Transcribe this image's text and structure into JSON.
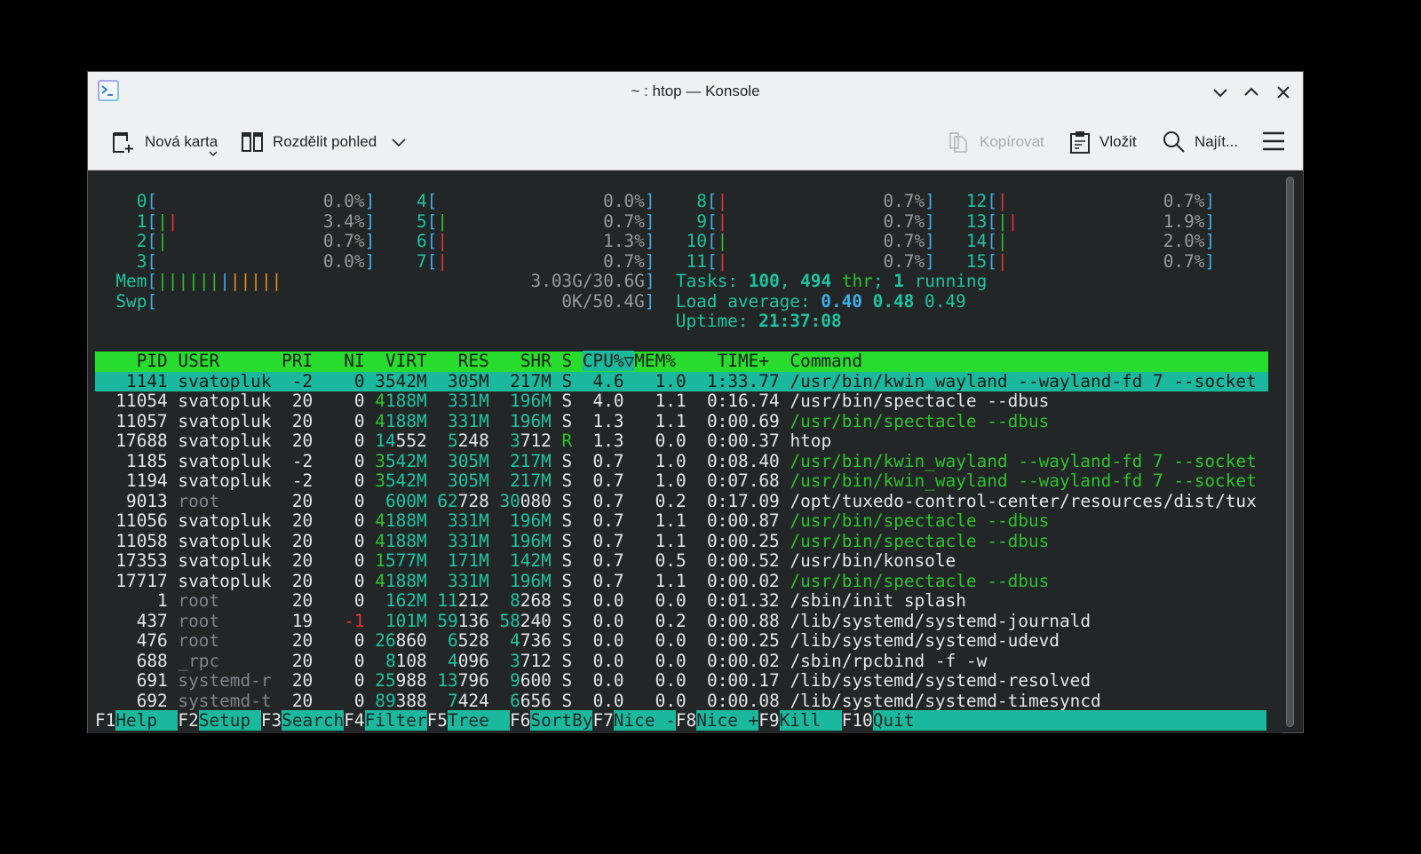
{
  "window": {
    "title": "~ : htop — Konsole"
  },
  "toolbar": {
    "new_tab": "Nová karta",
    "split_view": "Rozdělit pohled",
    "copy": "Kopírovat",
    "paste": "Vložit",
    "find": "Najít..."
  },
  "colors": {
    "terminal_bg": "#232627",
    "header_green": "#27dc2c",
    "selection_teal": "#1ab89c"
  },
  "meters": {
    "cpus": [
      {
        "label": "0",
        "value": "0.0%",
        "bars": ""
      },
      {
        "label": "1",
        "value": "3.4%",
        "bars": "gr"
      },
      {
        "label": "2",
        "value": "0.7%",
        "bars": "g"
      },
      {
        "label": "3",
        "value": "0.0%",
        "bars": ""
      },
      {
        "label": "4",
        "value": "0.0%",
        "bars": ""
      },
      {
        "label": "5",
        "value": "0.7%",
        "bars": "g"
      },
      {
        "label": "6",
        "value": "1.3%",
        "bars": "r"
      },
      {
        "label": "7",
        "value": "0.7%",
        "bars": "r"
      },
      {
        "label": "8",
        "value": "0.7%",
        "bars": "r"
      },
      {
        "label": "9",
        "value": "0.7%",
        "bars": "r"
      },
      {
        "label": "10",
        "value": "0.7%",
        "bars": "g"
      },
      {
        "label": "11",
        "value": "0.7%",
        "bars": "r"
      },
      {
        "label": "12",
        "value": "0.7%",
        "bars": "r"
      },
      {
        "label": "13",
        "value": "1.9%",
        "bars": "gr"
      },
      {
        "label": "14",
        "value": "2.0%",
        "bars": "g"
      },
      {
        "label": "15",
        "value": "0.7%",
        "bars": "r"
      }
    ],
    "mem": {
      "label": "Mem",
      "value": "3.03G/30.6G",
      "bars": "ggggggbooooo"
    },
    "swp": {
      "label": "Swp",
      "value": "0K/50.4G",
      "bars": ""
    },
    "tasks": {
      "label": "Tasks: ",
      "tasks": "100",
      "threads": "494",
      "thr_label": " thr",
      "running": "1",
      "running_label": " running"
    },
    "load": {
      "label": "Load average: ",
      "l1": "0.40",
      "l5": "0.48",
      "l15": "0.49"
    },
    "uptime": {
      "label": "Uptime: ",
      "value": "21:37:08"
    }
  },
  "processes": {
    "columns": {
      "pid": "PID",
      "user": "USER",
      "pri": "PRI",
      "ni": "NI",
      "virt": "VIRT",
      "res": "RES",
      "shr": "SHR",
      "s": "S",
      "cpu": "CPU%▽",
      "mem": "MEM%",
      "time": "TIME+",
      "cmd": "Command"
    },
    "selected_index": 0,
    "rows": [
      {
        "pid": "1141",
        "user": "svatopluk",
        "pri": "-2",
        "ni": "0",
        "virt": "3542M",
        "res": "305M",
        "shr": "217M",
        "s": "S",
        "cpu": "4.6",
        "mem": "1.0",
        "time": "1:33.77",
        "cmd": "/usr/bin/kwin_wayland --wayland-fd 7 --socket",
        "thread": false,
        "sys": false
      },
      {
        "pid": "11054",
        "user": "svatopluk",
        "pri": "20",
        "ni": "0",
        "virt": "4188M",
        "res": "331M",
        "shr": "196M",
        "s": "S",
        "cpu": "4.0",
        "mem": "1.1",
        "time": "0:16.74",
        "cmd": "/usr/bin/spectacle --dbus",
        "thread": false,
        "sys": false
      },
      {
        "pid": "11057",
        "user": "svatopluk",
        "pri": "20",
        "ni": "0",
        "virt": "4188M",
        "res": "331M",
        "shr": "196M",
        "s": "S",
        "cpu": "1.3",
        "mem": "1.1",
        "time": "0:00.69",
        "cmd": "/usr/bin/spectacle --dbus",
        "thread": true,
        "sys": false
      },
      {
        "pid": "17688",
        "user": "svatopluk",
        "pri": "20",
        "ni": "0",
        "virt": "14552",
        "res": "5248",
        "shr": "3712",
        "s": "R",
        "cpu": "1.3",
        "mem": "0.0",
        "time": "0:00.37",
        "cmd": "htop",
        "thread": false,
        "sys": false
      },
      {
        "pid": "1185",
        "user": "svatopluk",
        "pri": "-2",
        "ni": "0",
        "virt": "3542M",
        "res": "305M",
        "shr": "217M",
        "s": "S",
        "cpu": "0.7",
        "mem": "1.0",
        "time": "0:08.40",
        "cmd": "/usr/bin/kwin_wayland --wayland-fd 7 --socket",
        "thread": true,
        "sys": false
      },
      {
        "pid": "1194",
        "user": "svatopluk",
        "pri": "-2",
        "ni": "0",
        "virt": "3542M",
        "res": "305M",
        "shr": "217M",
        "s": "S",
        "cpu": "0.7",
        "mem": "1.0",
        "time": "0:07.68",
        "cmd": "/usr/bin/kwin_wayland --wayland-fd 7 --socket",
        "thread": true,
        "sys": false
      },
      {
        "pid": "9013",
        "user": "root",
        "pri": "20",
        "ni": "0",
        "virt": "600M",
        "res": "62728",
        "shr": "30080",
        "s": "S",
        "cpu": "0.7",
        "mem": "0.2",
        "time": "0:17.09",
        "cmd": "/opt/tuxedo-control-center/resources/dist/tux",
        "thread": false,
        "sys": true
      },
      {
        "pid": "11056",
        "user": "svatopluk",
        "pri": "20",
        "ni": "0",
        "virt": "4188M",
        "res": "331M",
        "shr": "196M",
        "s": "S",
        "cpu": "0.7",
        "mem": "1.1",
        "time": "0:00.87",
        "cmd": "/usr/bin/spectacle --dbus",
        "thread": true,
        "sys": false
      },
      {
        "pid": "11058",
        "user": "svatopluk",
        "pri": "20",
        "ni": "0",
        "virt": "4188M",
        "res": "331M",
        "shr": "196M",
        "s": "S",
        "cpu": "0.7",
        "mem": "1.1",
        "time": "0:00.25",
        "cmd": "/usr/bin/spectacle --dbus",
        "thread": true,
        "sys": false
      },
      {
        "pid": "17353",
        "user": "svatopluk",
        "pri": "20",
        "ni": "0",
        "virt": "1577M",
        "res": "171M",
        "shr": "142M",
        "s": "S",
        "cpu": "0.7",
        "mem": "0.5",
        "time": "0:00.52",
        "cmd": "/usr/bin/konsole",
        "thread": false,
        "sys": false
      },
      {
        "pid": "17717",
        "user": "svatopluk",
        "pri": "20",
        "ni": "0",
        "virt": "4188M",
        "res": "331M",
        "shr": "196M",
        "s": "S",
        "cpu": "0.7",
        "mem": "1.1",
        "time": "0:00.02",
        "cmd": "/usr/bin/spectacle --dbus",
        "thread": true,
        "sys": false
      },
      {
        "pid": "1",
        "user": "root",
        "pri": "20",
        "ni": "0",
        "virt": "162M",
        "res": "11212",
        "shr": "8268",
        "s": "S",
        "cpu": "0.0",
        "mem": "0.0",
        "time": "0:01.32",
        "cmd": "/sbin/init splash",
        "thread": false,
        "sys": true
      },
      {
        "pid": "437",
        "user": "root",
        "pri": "19",
        "ni": "-1",
        "virt": "101M",
        "res": "59136",
        "shr": "58240",
        "s": "S",
        "cpu": "0.0",
        "mem": "0.2",
        "time": "0:00.88",
        "cmd": "/lib/systemd/systemd-journald",
        "thread": false,
        "sys": true
      },
      {
        "pid": "476",
        "user": "root",
        "pri": "20",
        "ni": "0",
        "virt": "26860",
        "res": "6528",
        "shr": "4736",
        "s": "S",
        "cpu": "0.0",
        "mem": "0.0",
        "time": "0:00.25",
        "cmd": "/lib/systemd/systemd-udevd",
        "thread": false,
        "sys": true
      },
      {
        "pid": "688",
        "user": "_rpc",
        "pri": "20",
        "ni": "0",
        "virt": "8108",
        "res": "4096",
        "shr": "3712",
        "s": "S",
        "cpu": "0.0",
        "mem": "0.0",
        "time": "0:00.02",
        "cmd": "/sbin/rpcbind -f -w",
        "thread": false,
        "sys": true
      },
      {
        "pid": "691",
        "user": "systemd-r",
        "pri": "20",
        "ni": "0",
        "virt": "25988",
        "res": "13796",
        "shr": "9600",
        "s": "S",
        "cpu": "0.0",
        "mem": "0.0",
        "time": "0:00.17",
        "cmd": "/lib/systemd/systemd-resolved",
        "thread": false,
        "sys": true
      },
      {
        "pid": "692",
        "user": "systemd-t",
        "pri": "20",
        "ni": "0",
        "virt": "89388",
        "res": "7424",
        "shr": "6656",
        "s": "S",
        "cpu": "0.0",
        "mem": "0.0",
        "time": "0:00.08",
        "cmd": "/lib/systemd/systemd-timesyncd",
        "thread": false,
        "sys": true
      }
    ]
  },
  "footer": [
    {
      "key": "F1",
      "label": "Help"
    },
    {
      "key": "F2",
      "label": "Setup"
    },
    {
      "key": "F3",
      "label": "Search"
    },
    {
      "key": "F4",
      "label": "Filter"
    },
    {
      "key": "F5",
      "label": "Tree"
    },
    {
      "key": "F6",
      "label": "SortBy"
    },
    {
      "key": "F7",
      "label": "Nice -"
    },
    {
      "key": "F8",
      "label": "Nice +"
    },
    {
      "key": "F9",
      "label": "Kill"
    },
    {
      "key": "F10",
      "label": "Quit"
    }
  ]
}
